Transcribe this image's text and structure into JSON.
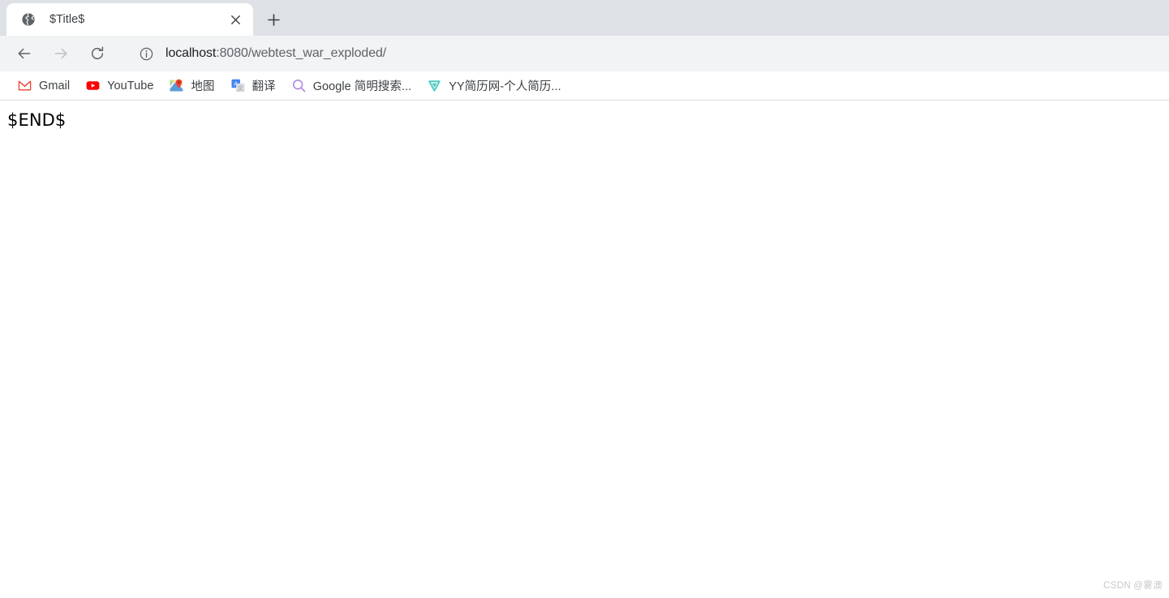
{
  "tab": {
    "favicon": "globe-icon",
    "title": "$Title$",
    "close_label": "×",
    "newtab_label": "+"
  },
  "toolbar": {
    "back_label": "←",
    "forward_label": "→",
    "reload_label": "↻",
    "site_info_icon": "info-circle-icon",
    "url_host": "localhost",
    "url_rest": ":8080/webtest_war_exploded/",
    "url_full": "localhost:8080/webtest_war_exploded/"
  },
  "bookmarks": [
    {
      "label": "Gmail",
      "icon": "gmail-icon"
    },
    {
      "label": "YouTube",
      "icon": "youtube-icon"
    },
    {
      "label": "地图",
      "icon": "google-maps-icon"
    },
    {
      "label": "翻译",
      "icon": "google-translate-icon"
    },
    {
      "label": "Google 简明搜索...",
      "icon": "search-magnifier-icon"
    },
    {
      "label": "YY简历网-个人简历...",
      "icon": "yy-resume-icon"
    }
  ],
  "page": {
    "body_text": "$END$",
    "watermark": "CSDN @雾澳"
  },
  "colors": {
    "tabstrip_bg": "#dee1e6",
    "toolbar_bg": "#f1f3f4",
    "active_tab_bg": "#ffffff",
    "url_host_color": "#202124",
    "url_rest_color": "#5f6368",
    "gmail_red": "#ea4335",
    "youtube_red": "#ff0000",
    "translate_blue": "#4285f4",
    "search_purple": "#b08ae0",
    "yy_teal": "#4ecdc4"
  }
}
